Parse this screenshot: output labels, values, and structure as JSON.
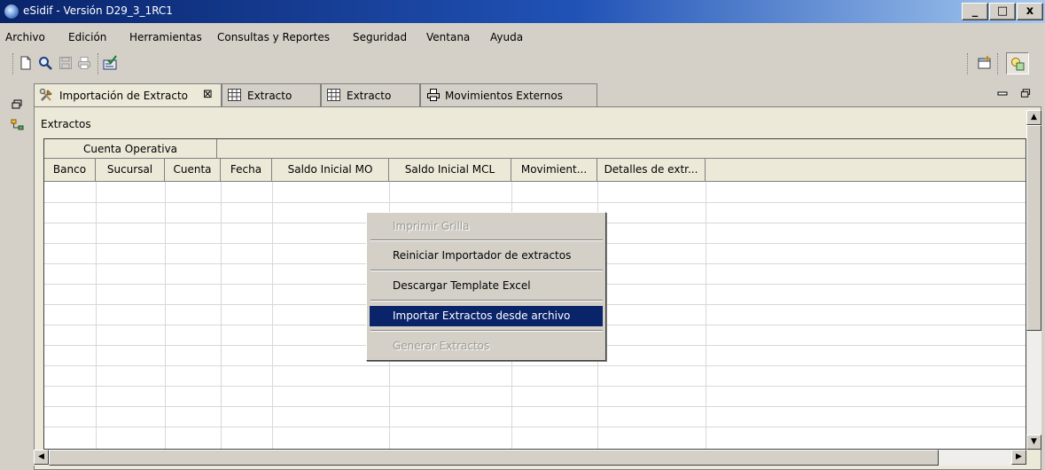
{
  "window": {
    "title": "eSidif - Versión D29_3_1RC1",
    "minimize": "_",
    "maximize": "□",
    "close": "x"
  },
  "menubar": [
    "Archivo",
    "Edición",
    "Herramientas",
    "Consultas y Reportes",
    "Seguridad",
    "Ventana",
    "Ayuda"
  ],
  "tabs": [
    {
      "label": "Importación de Extracto",
      "icon": "tools-icon",
      "close": "⊠"
    },
    {
      "label": "Extracto",
      "icon": "grid-icon"
    },
    {
      "label": "Extracto",
      "icon": "grid-icon"
    },
    {
      "label": "Movimientos Externos",
      "icon": "printer-icon"
    }
  ],
  "section": {
    "title": "Extractos"
  },
  "grid": {
    "group_header": "Cuenta Operativa",
    "columns": [
      "Banco",
      "Sucursal",
      "Cuenta",
      "Fecha",
      "Saldo Inicial MO",
      "Saldo Inicial MCL",
      "Movimient...",
      "Detalles de extr..."
    ]
  },
  "context_menu": {
    "items": [
      {
        "label": "Imprimir Grilla",
        "state": "disabled"
      },
      {
        "label": "Reiniciar Importador de extractos",
        "state": "enabled"
      },
      {
        "label": "Descargar Template Excel",
        "state": "enabled"
      },
      {
        "label": "Importar Extractos desde archivo",
        "state": "selected"
      },
      {
        "label": "Generar Extractos",
        "state": "disabled"
      }
    ]
  },
  "colors": {
    "titlebar": "#0a246a",
    "selection": "#0a246a",
    "panel": "#ece9d8"
  }
}
